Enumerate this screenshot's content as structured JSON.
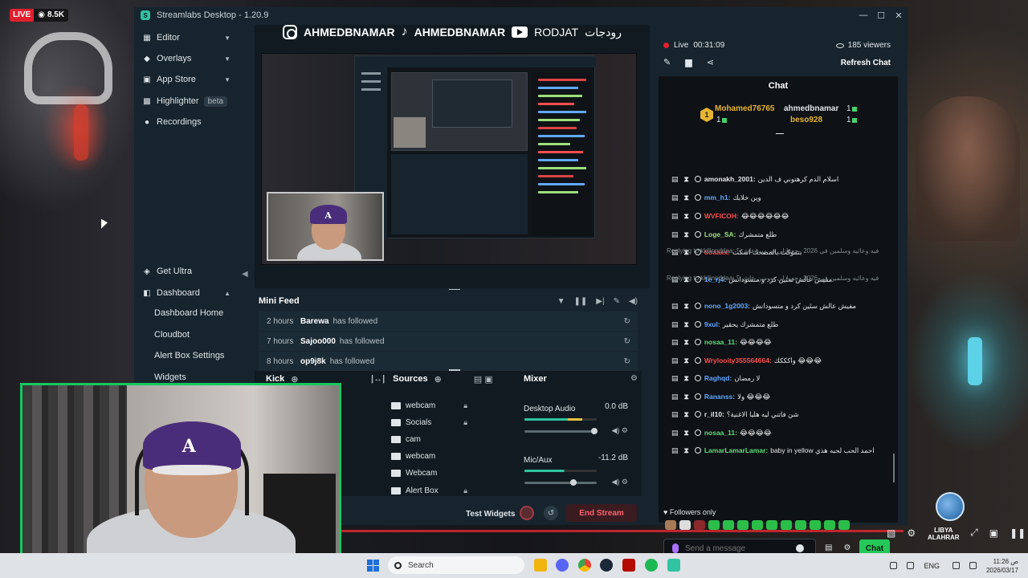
{
  "overlay": {
    "live_label": "LIVE",
    "viewer_count": "8.5K",
    "watermark_top": "LIBYA",
    "watermark_bottom": "ALAHRAR"
  },
  "window": {
    "title": "Streamlabs Desktop - 1.20.9",
    "controls": [
      "—",
      "☐",
      "✕"
    ]
  },
  "socials": {
    "instagram": "AHMEDBNAMAR",
    "tiktok": "AHMEDBNAMAR",
    "youtube": "RODJAT",
    "youtube_arabic": "رودجات"
  },
  "sidebar": {
    "items": [
      {
        "label": "Editor",
        "icon": "editor-icon"
      },
      {
        "label": "Overlays",
        "icon": "overlays-icon"
      },
      {
        "label": "App Store",
        "icon": "app-store-icon"
      },
      {
        "label": "Highlighter",
        "icon": "highlighter-icon",
        "badge": "beta"
      },
      {
        "label": "Recordings",
        "icon": "recordings-icon"
      }
    ],
    "get_ultra": "Get Ultra",
    "dashboard": "Dashboard",
    "dashboard_sub": [
      "Dashboard Home",
      "Cloudbot",
      "Alert Box Settings",
      "Widgets"
    ]
  },
  "minifeed": {
    "title": "Mini Feed",
    "rows": [
      {
        "time": "2 hours",
        "name": "Barewa",
        "action": "has followed"
      },
      {
        "time": "7 hours",
        "name": "Sajoo000",
        "action": "has followed"
      },
      {
        "time": "8 hours",
        "name": "op9j8k",
        "action": "has followed"
      }
    ]
  },
  "scenes": {
    "title": "Kick"
  },
  "sources": {
    "title": "Sources",
    "items": [
      "webcam",
      "Socials",
      "cam",
      "webcam",
      "Webcam",
      "Alert Box"
    ]
  },
  "mixer": {
    "title": "Mixer",
    "items": [
      {
        "name": "Desktop Audio",
        "db": "0.0 dB",
        "level": 0.68
      },
      {
        "name": "Mic/Aux",
        "db": "-11.2 dB",
        "level": 0.62
      }
    ]
  },
  "controls": {
    "test_widgets": "Test Widgets",
    "end_stream": "End Stream"
  },
  "live": {
    "status": "Live",
    "duration": "00:31:09",
    "viewers": "185 viewers",
    "refresh_chat": "Refresh Chat"
  },
  "chat": {
    "title": "Chat",
    "leaders": [
      {
        "name": "Mohamed76765",
        "count": "1",
        "color": "#e6b433"
      },
      {
        "name": "ahmedbnamar",
        "count": "1",
        "color": "#dfe5e9"
      },
      {
        "name": "beso928",
        "count": "1",
        "color": "#e6b433"
      }
    ],
    "medal_rank": "1",
    "messages": [
      {
        "user": "amonakh_2001:",
        "color": "#e6e8ea",
        "text": "اسلام الدم كرهتوني ف الدين"
      },
      {
        "user": "mm_h1:",
        "color": "#5fa8ff",
        "text": "وين خلابك"
      },
      {
        "user": "WVFICOH:",
        "color": "#ff4d4d",
        "text": "😂😂😂😂😂😂"
      },
      {
        "user": "Loge_SA:",
        "color": "#9be07a",
        "text": "طلع متمشرك"
      },
      {
        "user": "doaaxx:",
        "color": "#ff4d4d",
        "text": "بتموكت بالمصحك اسكت"
      },
      {
        "user": "1e_rj4:",
        "color": "#5fa8ff",
        "text": "مفيش عالش سئين كرد و متسودانش"
      },
      {
        "user": "nono_1g2003:",
        "color": "#5fa8ff",
        "text": "مفيش عالش سئين كرد و متسودانش"
      },
      {
        "user": "9xul:",
        "color": "#5fa8ff",
        "text": "طلع متمشرك يحقير"
      },
      {
        "user": "nosaa_11:",
        "color": "#5fdd7a",
        "text": "😂😂😂😂"
      },
      {
        "user": "Wrylooity355564664:",
        "color": "#ff4d4d",
        "text": "واكككك 😂😂😂"
      },
      {
        "user": "Raghqd:",
        "color": "#5fa8ff",
        "text": "لا رمضان"
      },
      {
        "user": "Rananss:",
        "color": "#5fa8ff",
        "text": "ولا 😂😂😂"
      },
      {
        "user": "r_il10:",
        "color": "#e6e8ea",
        "text": "شن فاتني ليه هليا الاغنية؟"
      },
      {
        "user": "nosaa_11:",
        "color": "#5fdd7a",
        "text": "😂😂😂😂"
      },
      {
        "user": "LamarLamarLamar:",
        "color": "#5fdd7a",
        "text": "baby in yellow احمد الحب لحبه هذي"
      }
    ],
    "reply_1": "Replying to kkilinnddaa: فيه وعائيه وسلمين في 2026 رجعوا لي نورمين عاش ؟",
    "reply_2": "Replying to kkilinnddaa: فيه وعائيه وسلمين في 2026 رجعوا لي نورمين عاش ؟",
    "followers_only": "Followers only",
    "input_placeholder": "Send a message",
    "send_label": "Chat"
  },
  "taskbar": {
    "search_placeholder": "Search",
    "language": "ENG",
    "time": "11:26 ص",
    "date": "2026/03/17"
  }
}
